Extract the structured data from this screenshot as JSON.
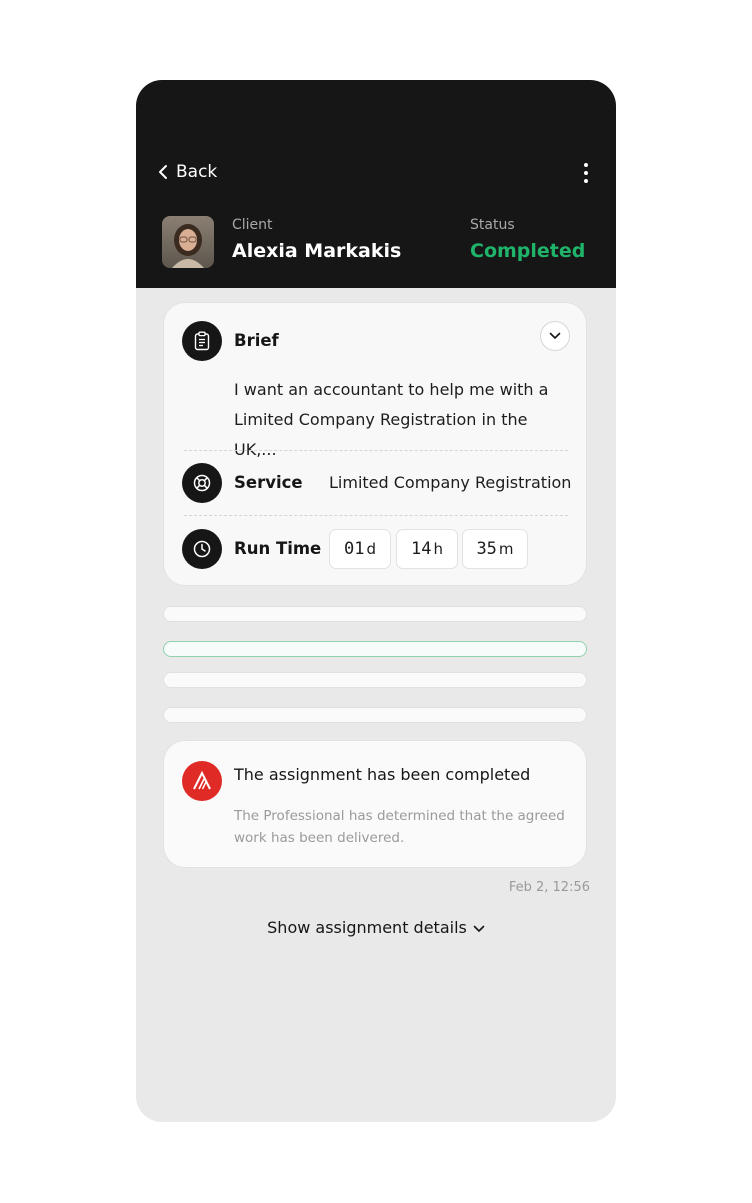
{
  "header": {
    "back_label": "Back",
    "client_label": "Client",
    "client_name": "Alexia Markakis",
    "status_label": "Status",
    "status_value": "Completed"
  },
  "brief_card": {
    "brief_label": "Brief",
    "brief_text": "I want an accountant to help me with a Limited Company Registration in the UK,...",
    "service_label": "Service",
    "service_value": "Limited Company Registration",
    "run_time_label": "Run Time",
    "run_time": [
      {
        "value": "01",
        "unit": "d"
      },
      {
        "value": "14",
        "unit": "h"
      },
      {
        "value": "35",
        "unit": "m"
      }
    ]
  },
  "notice": {
    "title": "The assignment has been completed",
    "body": "The Professional has determined that the agreed work has been delivered.",
    "timestamp": "Feb 2, 12:56"
  },
  "footer": {
    "details_label": "Show assignment details"
  },
  "colors": {
    "header_bg": "#161616",
    "status": "#1fb46a",
    "brand": "#e02a25",
    "active_bar_border": "#8fd2ae"
  },
  "icons": [
    "chevron-left-icon",
    "more-vertical-icon",
    "clipboard-icon",
    "lifebuoy-icon",
    "clock-icon",
    "chevron-down-icon",
    "brand-logo-icon"
  ]
}
